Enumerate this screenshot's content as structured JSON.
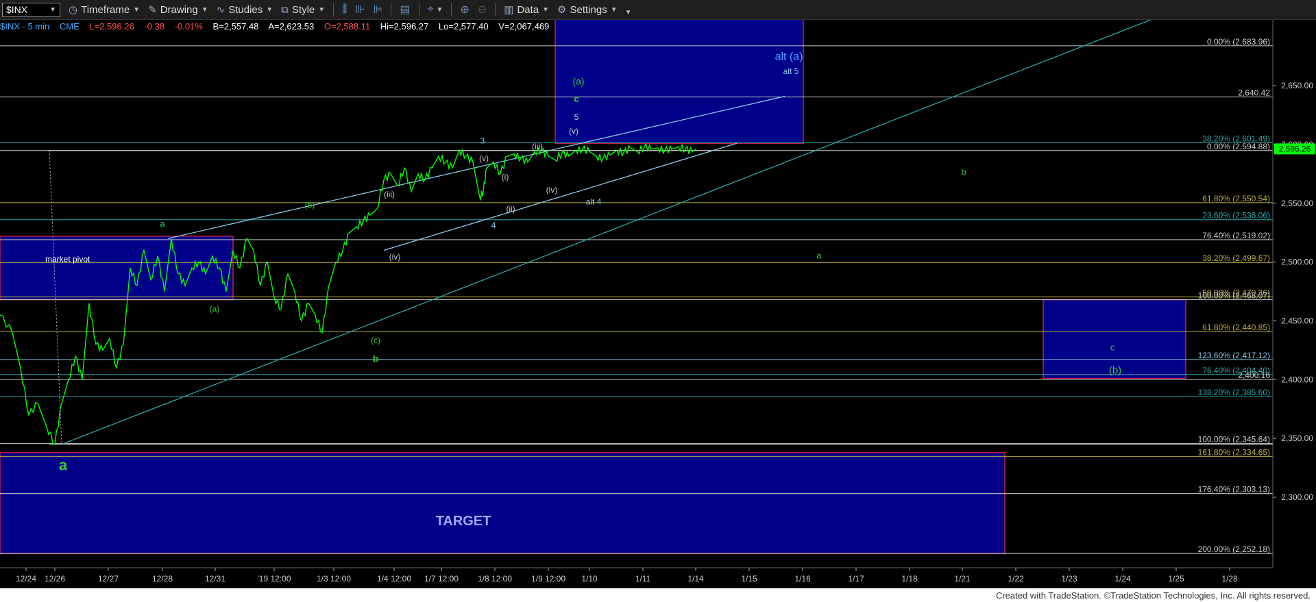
{
  "toolbar": {
    "symbol": "$INX",
    "timeframe": "Timeframe",
    "drawing": "Drawing",
    "studies": "Studies",
    "style": "Style",
    "data": "Data",
    "settings": "Settings"
  },
  "quote": {
    "symbol_label": "$INX - 5 min",
    "exchange": "CME",
    "last": "L=2,596.26",
    "change": "-0.38",
    "pct": "-0.01%",
    "bid": "B=2,557.48",
    "ask": "A=2,623.53",
    "open": "O=2,588.11",
    "high": "Hi=2,596.27",
    "low": "Lo=2,577.40",
    "volume": "V=2,067,469",
    "colors": {
      "label": "#3fa9ff",
      "up": "#00ff00",
      "down": "#ff5050",
      "text": "#ffffff"
    }
  },
  "footer": "Created with TradeStation. ©TradeStation Technologies, Inc. All rights reserved.",
  "chart_data": {
    "type": "line",
    "title": "",
    "ylim": [
      2240,
      2706
    ],
    "y_ticks": [
      "2,650.00",
      "2,600.00",
      "2,550.00",
      "2,500.00",
      "2,450.00",
      "2,400.00",
      "2,350.00",
      "2,300.00"
    ],
    "y_tick_values": [
      2650,
      2600,
      2550,
      2500,
      2450,
      2400,
      2350,
      2300
    ],
    "x_ticks": [
      "12/24",
      "12/26",
      "12/27",
      "12/28",
      "12/31",
      "'19 12:00",
      "1/3 12:00",
      "1/4 12:00",
      "1/7 12:00",
      "1/8 12:00",
      "1/9 12:00",
      "1/10",
      "1/11",
      "1/14",
      "1/15",
      "1/16",
      "1/17",
      "1/18",
      "1/21",
      "1/22",
      "1/23",
      "1/24",
      "1/25",
      "1/28"
    ],
    "x_tick_index": [
      38,
      80,
      158,
      237,
      314,
      400,
      487,
      575,
      644,
      722,
      800,
      860,
      938,
      1015,
      1093,
      1171,
      1249,
      1327,
      1404,
      1482,
      1560,
      1638,
      1716,
      1794
    ],
    "price_series": {
      "x": [
        0,
        18,
        30,
        42,
        55,
        68,
        80,
        90,
        100,
        110,
        120,
        130,
        140,
        150,
        160,
        170,
        180,
        190,
        200,
        210,
        220,
        230,
        240,
        250,
        260,
        270,
        280,
        290,
        300,
        310,
        320,
        330,
        340,
        350,
        360,
        370,
        380,
        390,
        400,
        410,
        420,
        430,
        440,
        450,
        460,
        470,
        480,
        490,
        500,
        510,
        520,
        530,
        540,
        550,
        560,
        570,
        580,
        590,
        600,
        610,
        620,
        630,
        640,
        650,
        660,
        670,
        680,
        690,
        700,
        705,
        710,
        720,
        730,
        740,
        750,
        760,
        770,
        780,
        790,
        800,
        810,
        820,
        830,
        840,
        850,
        860,
        870,
        880,
        890,
        900,
        910,
        920,
        930,
        940,
        950,
        960,
        970,
        980,
        990,
        1000,
        1010,
        1015
      ],
      "y": [
        2455,
        2440,
        2410,
        2370,
        2380,
        2360,
        2345,
        2380,
        2400,
        2420,
        2400,
        2465,
        2430,
        2425,
        2435,
        2410,
        2430,
        2495,
        2480,
        2510,
        2485,
        2505,
        2475,
        2520,
        2490,
        2480,
        2495,
        2500,
        2490,
        2505,
        2495,
        2475,
        2510,
        2495,
        2520,
        2510,
        2480,
        2500,
        2470,
        2460,
        2490,
        2475,
        2450,
        2465,
        2455,
        2440,
        2480,
        2500,
        2510,
        2525,
        2530,
        2535,
        2540,
        2545,
        2570,
        2575,
        2565,
        2580,
        2560,
        2575,
        2570,
        2580,
        2590,
        2585,
        2580,
        2595,
        2590,
        2585,
        2555,
        2560,
        2580,
        2585,
        2575,
        2590,
        2592,
        2588,
        2585,
        2594,
        2595,
        2590,
        2587,
        2593,
        2590,
        2595,
        2596,
        2594,
        2590,
        2588,
        2591,
        2595,
        2593,
        2597,
        2594,
        2598,
        2596,
        2597,
        2595,
        2596,
        2598,
        2596,
        2594,
        2596
      ],
      "color": "#00ff00"
    },
    "fib_levels": [
      {
        "label": "0.00% (2,683.96)",
        "value": 2683.96,
        "color": "#cccccc"
      },
      {
        "label": "2,640.42",
        "value": 2640.42,
        "color": "#cccccc"
      },
      {
        "label": "38.20% (2,601.49)",
        "value": 2601.49,
        "color": "#2aa6a6"
      },
      {
        "label": "0.00% (2,594.88)",
        "value": 2594.88,
        "color": "#cccccc"
      },
      {
        "label": "61.80% (2,550.54)",
        "value": 2550.54,
        "color": "#b8b040"
      },
      {
        "label": "23.60% (2,536.06)",
        "value": 2536.06,
        "color": "#2aa6a6"
      },
      {
        "label": "76.40% (2,519.02)",
        "value": 2519.02,
        "color": "#cccccc"
      },
      {
        "label": "38.20% (2,499.67)",
        "value": 2499.67,
        "color": "#b8b040"
      },
      {
        "label": "50.00% (2,470.36)",
        "value": 2470.36,
        "color": "#b8b040"
      },
      {
        "label": "100.00% (2,468.07)",
        "value": 2468.07,
        "color": "#cccccc"
      },
      {
        "label": "61.80% (2,440.85)",
        "value": 2440.85,
        "color": "#b8b040"
      },
      {
        "label": "123.60% (2,417.12)",
        "value": 2417.12,
        "color": "#87ceeb"
      },
      {
        "label": "76.40% (2,404.40)",
        "value": 2404.4,
        "color": "#2aa6a6"
      },
      {
        "label": "2,400.16",
        "value": 2400.16,
        "color": "#cccccc"
      },
      {
        "label": "138.20% (2,385.60)",
        "value": 2385.6,
        "color": "#2aa6a6"
      },
      {
        "label": "100.00% (2,345.64)",
        "value": 2345.64,
        "color": "#cccccc"
      },
      {
        "label": "161.80% (2,334.65)",
        "value": 2334.65,
        "color": "#b8b040"
      },
      {
        "label": "176.40% (2,303.13)",
        "value": 2303.13,
        "color": "#cccccc"
      },
      {
        "label": "200.00% (2,252.18)",
        "value": 2252.18,
        "color": "#cccccc"
      }
    ],
    "last_price_tag": {
      "label": "2,596.26",
      "value": 2596.26,
      "color": "#00ff00"
    },
    "zones": [
      {
        "x0": 0,
        "x1": 340,
        "y0": 2468,
        "y1": 2522,
        "label": "market pivot"
      },
      {
        "x0": 810,
        "x1": 1172,
        "y0": 2601,
        "y1": 2719,
        "label": ""
      },
      {
        "x0": 1522,
        "x1": 1730,
        "y0": 2401,
        "y1": 2468,
        "label": ""
      },
      {
        "x0": 0,
        "x1": 1466,
        "y0": 2252,
        "y1": 2338,
        "label": "TARGET"
      }
    ],
    "trend_lines": [
      {
        "x0": 245,
        "y0": 2520,
        "x1": 1145,
        "y1": 2641,
        "color": "#87ceeb"
      },
      {
        "x0": 560,
        "y0": 2510,
        "x1": 1075,
        "y1": 2601,
        "color": "#87ceeb"
      },
      {
        "x0": 90,
        "y0": 2345,
        "x1": 1705,
        "y1": 2712,
        "color": "#2aa6a6"
      }
    ],
    "wave_labels": [
      {
        "text": "a",
        "x": 92,
        "y": 2323,
        "color": "#32cd32",
        "size": 22,
        "bold": true
      },
      {
        "text": "a",
        "x": 237,
        "y": 2530,
        "color": "#32cd32",
        "size": 13
      },
      {
        "text": "(a)",
        "x": 313,
        "y": 2458,
        "color": "#32cd32",
        "size": 12
      },
      {
        "text": "(b)",
        "x": 452,
        "y": 2546,
        "color": "#32cd32",
        "size": 12
      },
      {
        "text": "(c)",
        "x": 548,
        "y": 2431,
        "color": "#32cd32",
        "size": 12
      },
      {
        "text": "b",
        "x": 548,
        "y": 2415,
        "color": "#32cd32",
        "size": 14,
        "bold": true
      },
      {
        "text": "(iii)",
        "x": 568,
        "y": 2555,
        "color": "#cccccc",
        "size": 12
      },
      {
        "text": "(iv)",
        "x": 576,
        "y": 2502,
        "color": "#cccccc",
        "size": 12
      },
      {
        "text": "3",
        "x": 704,
        "y": 2601,
        "color": "#87ceeb",
        "size": 12
      },
      {
        "text": "(v)",
        "x": 706,
        "y": 2586,
        "color": "#cccccc",
        "size": 12
      },
      {
        "text": "(i)",
        "x": 737,
        "y": 2570,
        "color": "#cccccc",
        "size": 12
      },
      {
        "text": "(ii)",
        "x": 745,
        "y": 2543,
        "color": "#cccccc",
        "size": 12
      },
      {
        "text": "4",
        "x": 720,
        "y": 2529,
        "color": "#87ceeb",
        "size": 12
      },
      {
        "text": "(iii)",
        "x": 784,
        "y": 2596,
        "color": "#cccccc",
        "size": 12
      },
      {
        "text": "(iv)",
        "x": 805,
        "y": 2559,
        "color": "#cccccc",
        "size": 12
      },
      {
        "text": "(v)",
        "x": 837,
        "y": 2609,
        "color": "#cccccc",
        "size": 12
      },
      {
        "text": "5",
        "x": 841,
        "y": 2621,
        "color": "#cccccc",
        "size": 12
      },
      {
        "text": "c",
        "x": 841,
        "y": 2636,
        "color": "#32cd32",
        "size": 14,
        "bold": true
      },
      {
        "text": "(a)",
        "x": 844,
        "y": 2651,
        "color": "#32cd32",
        "size": 14
      },
      {
        "text": "alt 4",
        "x": 866,
        "y": 2549,
        "color": "#87ceeb",
        "size": 12
      },
      {
        "text": "alt (a)",
        "x": 1151,
        "y": 2672,
        "color": "#3fa9ff",
        "size": 16
      },
      {
        "text": "alt 5",
        "x": 1154,
        "y": 2660,
        "color": "#87ceeb",
        "size": 12
      },
      {
        "text": "b",
        "x": 1406,
        "y": 2574,
        "color": "#32cd32",
        "size": 13
      },
      {
        "text": "a",
        "x": 1195,
        "y": 2503,
        "color": "#32cd32",
        "size": 13
      },
      {
        "text": "c",
        "x": 1623,
        "y": 2425,
        "color": "#32cd32",
        "size": 13
      },
      {
        "text": "(b)",
        "x": 1627,
        "y": 2405,
        "color": "#32cd32",
        "size": 15
      }
    ],
    "grid": false,
    "background": "#000000"
  }
}
